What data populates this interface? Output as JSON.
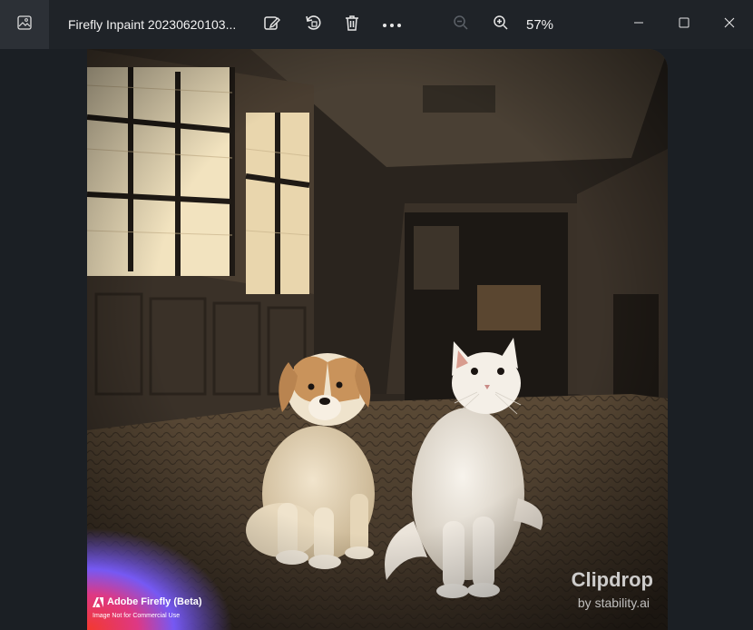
{
  "window": {
    "title": "Firefly Inpaint 20230620103...",
    "zoom_level": "57%"
  },
  "toolbar": {
    "icons": [
      "gallery-icon",
      "edit-image-icon",
      "rotate-icon",
      "delete-icon",
      "more-icon",
      "zoom-out-icon",
      "zoom-in-icon"
    ]
  },
  "window_controls": [
    "minimize-icon",
    "maximize-icon",
    "close-icon"
  ],
  "image": {
    "watermark_clipdrop": "Clipdrop",
    "watermark_by": "by stability.ai",
    "adobe_label": "Adobe Firefly (Beta)",
    "adobe_sub": "Image Not for Commercial Use"
  },
  "colors": {
    "titlebar": "#1f2328",
    "background": "#1b1f24",
    "accent_text": "#f1f1f1"
  }
}
